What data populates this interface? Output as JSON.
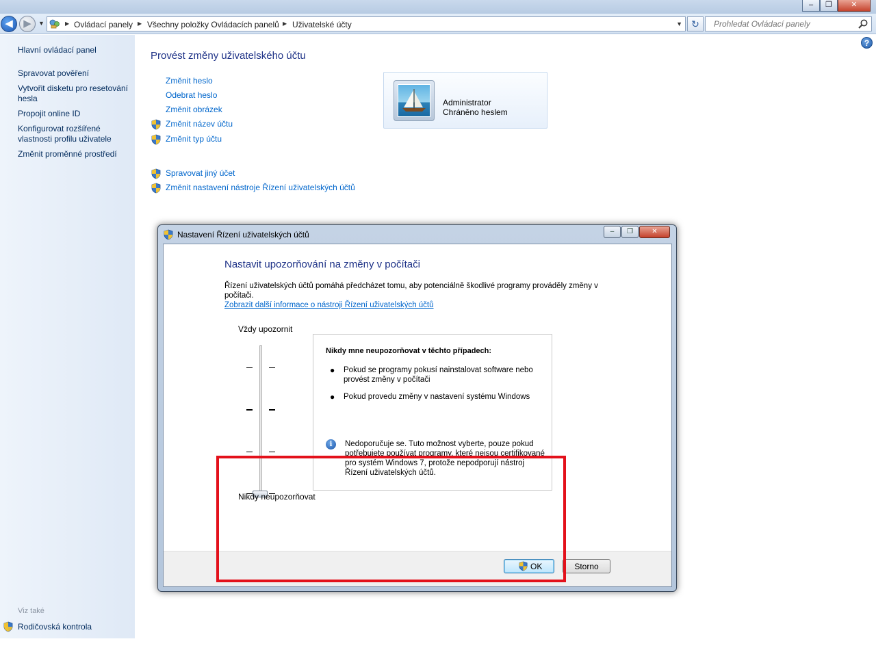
{
  "titlebar": {
    "minimize_symbol": "–",
    "maximize_symbol": "❐",
    "close_symbol": "✕"
  },
  "nav": {
    "back_symbol": "◀",
    "forward_symbol": "▶",
    "breadcrumbs": [
      "Ovládací panely",
      "Všechny položky Ovládacích panelů",
      "Uživatelské účty"
    ],
    "refresh_symbol": "↻",
    "search_placeholder": "Prohledat Ovládací panely"
  },
  "sidebar": {
    "items": [
      {
        "label": "Hlavní ovládací panel"
      },
      {
        "label": "Spravovat pověření"
      },
      {
        "label": "Vytvořit disketu pro resetování hesla"
      },
      {
        "label": "Propojit online ID"
      },
      {
        "label": "Konfigurovat rozšířené vlastnosti profilu uživatele"
      },
      {
        "label": "Změnit proměnné prostředí"
      }
    ],
    "see_also": "Viz také",
    "parental_control": "Rodičovská kontrola"
  },
  "help_symbol": "?",
  "main": {
    "title": "Provést změny uživatelského účtu",
    "links": [
      {
        "label": "Změnit heslo",
        "shield": false
      },
      {
        "label": "Odebrat heslo",
        "shield": false
      },
      {
        "label": "Změnit obrázek",
        "shield": false
      },
      {
        "label": "Změnit název účtu",
        "shield": true
      },
      {
        "label": "Změnit typ účtu",
        "shield": true
      }
    ],
    "links2": [
      {
        "label": "Spravovat jiný účet",
        "shield": true
      },
      {
        "label": "Změnit nastavení nástroje Řízení uživatelských účtů",
        "shield": true
      }
    ],
    "user": {
      "name": "Administrator",
      "status": "Chráněno heslem"
    }
  },
  "dialog": {
    "title": "Nastavení Řízení uživatelských účtů",
    "heading": "Nastavit upozorňování na změny v počítači",
    "description": "Řízení uživatelských účtů pomáhá předcházet tomu, aby potenciálně škodlivé programy prováděly změny v počítači.",
    "link": "Zobrazit další informace o nástroji Řízení uživatelských účtů",
    "slider": {
      "top_label": "Vždy upozornit",
      "bottom_label": "Nikdy neupozorňovat",
      "levels": 4,
      "selected_level": 1
    },
    "info": {
      "title": "Nikdy mne neupozorňovat v těchto případech:",
      "bullets": [
        "Pokud se programy pokusí nainstalovat software nebo provést změny v počítači",
        "Pokud provedu změny v nastavení systému Windows"
      ],
      "note_icon": "i",
      "note": "Nedoporučuje se. Tuto možnost vyberte, pouze pokud potřebujete používat programy, které nejsou certifikované pro systém Windows 7, protože nepodporují nástroj Řízení uživatelských účtů."
    },
    "ok_label": "OK",
    "cancel_label": "Storno",
    "annotation_color": "#e3111b"
  }
}
